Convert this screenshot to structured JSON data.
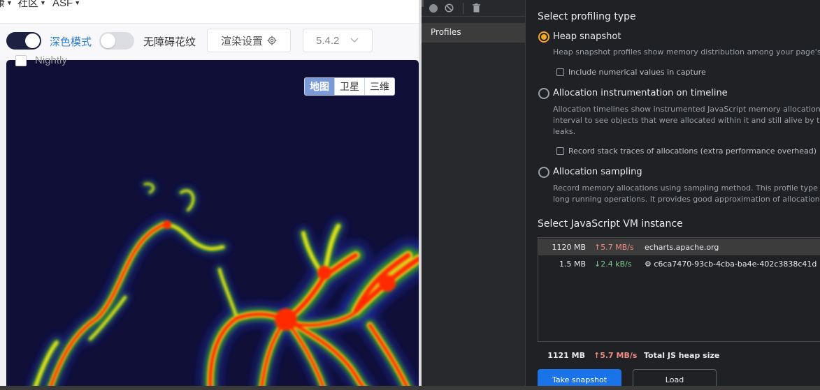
{
  "nav": {
    "item1": "康",
    "item2": "社区",
    "item3": "ASF"
  },
  "controls": {
    "dark_mode_label": "深色模式",
    "dark_mode_on": true,
    "a11y_label": "无障碍花纹",
    "a11y_on": false,
    "render_settings_label": "渲染设置",
    "version": "5.4.2",
    "nightly_label": "Nightly",
    "nightly_checked": false
  },
  "map": {
    "switch": [
      "地图",
      "卫星",
      "三维"
    ],
    "active_index": 0,
    "background_color": "#0f0f38",
    "heat_colors": [
      "#1e2aa8",
      "#2f8a2a",
      "#e0e01a",
      "#ff2a00"
    ]
  },
  "devtools": {
    "sidebar_item": "Profiles",
    "profiling_type_title": "Select profiling type",
    "options": [
      {
        "label": "Heap snapshot",
        "checked": true,
        "desc": [
          "Heap snapshot profiles show memory distribution among your page's JavaScript objects and related DOM nodes."
        ],
        "checkbox": "Include numerical values in capture"
      },
      {
        "label": "Allocation instrumentation on timeline",
        "checked": false,
        "desc": [
          "Allocation timelines show instrumented JavaScript memory allocations over time. Once profile is recorded you can select a time",
          "interval to see objects that were allocated within it and still alive by the end of recording. Use this profile type to isolate memory",
          "leaks."
        ],
        "checkbox": "Record stack traces of allocations (extra performance overhead)"
      },
      {
        "label": "Allocation sampling",
        "checked": false,
        "desc": [
          "Record memory allocations using sampling method. This profile type has minimal performance overhead and can be used for",
          "long running operations. It provides good approximation of allocations broken down by JavaScript execution stack."
        ]
      }
    ],
    "vm_title": "Select JavaScript VM instance",
    "vm_rows": [
      {
        "size": "1120 MB",
        "rate": "↑5.7 MB/s",
        "rate_dir": "up",
        "name": "echarts.apache.org",
        "selected": true
      },
      {
        "size": "1.5 MB",
        "rate": "↓2.4 kB/s",
        "rate_dir": "down",
        "name": "⚙ c6ca7470-93cb-4cba-ba4e-402c3838c41d",
        "selected": false
      }
    ],
    "total": {
      "size": "1121 MB",
      "rate": "↑5.7 MB/s",
      "label": "Total JS heap size"
    },
    "take_snapshot_label": "Take snapshot",
    "load_label": "Load",
    "accent_color": "#f5a623",
    "primary_button_color": "#1a73e8"
  }
}
